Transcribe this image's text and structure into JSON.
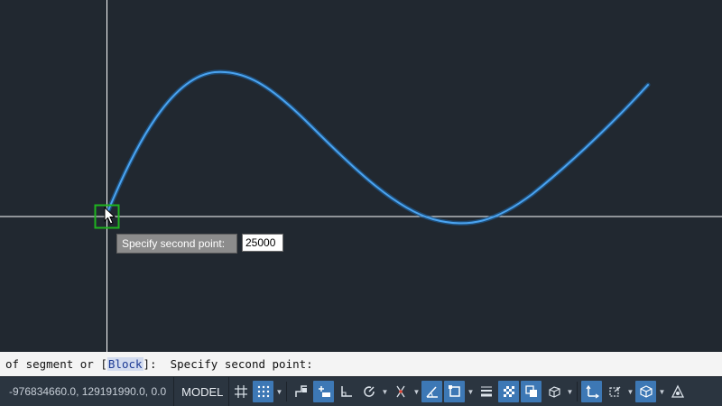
{
  "drawing": {
    "tooltip_prompt": "Specify second point:",
    "input_value": "25000"
  },
  "command_line": {
    "prefix": "of segment or [",
    "keyword": "Block",
    "suffix": "]:  Specify second point:"
  },
  "status_bar": {
    "coordinates": "-976834660.0, 129191990.0, 0.0",
    "space": "MODEL",
    "icons": [
      "grid-icon",
      "snap-icon",
      "infer-constraints-icon",
      "dynamic-input-icon",
      "ortho-icon",
      "polar-tracking-icon",
      "isodraft-icon",
      "object-snap-tracking-icon",
      "object-snap-icon",
      "lineweight-icon",
      "transparency-icon",
      "selection-cycling-icon",
      "3d-object-snap-icon",
      "dynamic-ucs-icon",
      "selection-filter-icon",
      "gizmo-icon",
      "annotation-visibility-icon"
    ]
  },
  "colors": {
    "canvas": "#212830",
    "polyline": "#4aa3f0",
    "crosshair": "#ffffff",
    "pickbox": "#1fb31f",
    "highlight": "#3d78b5"
  }
}
